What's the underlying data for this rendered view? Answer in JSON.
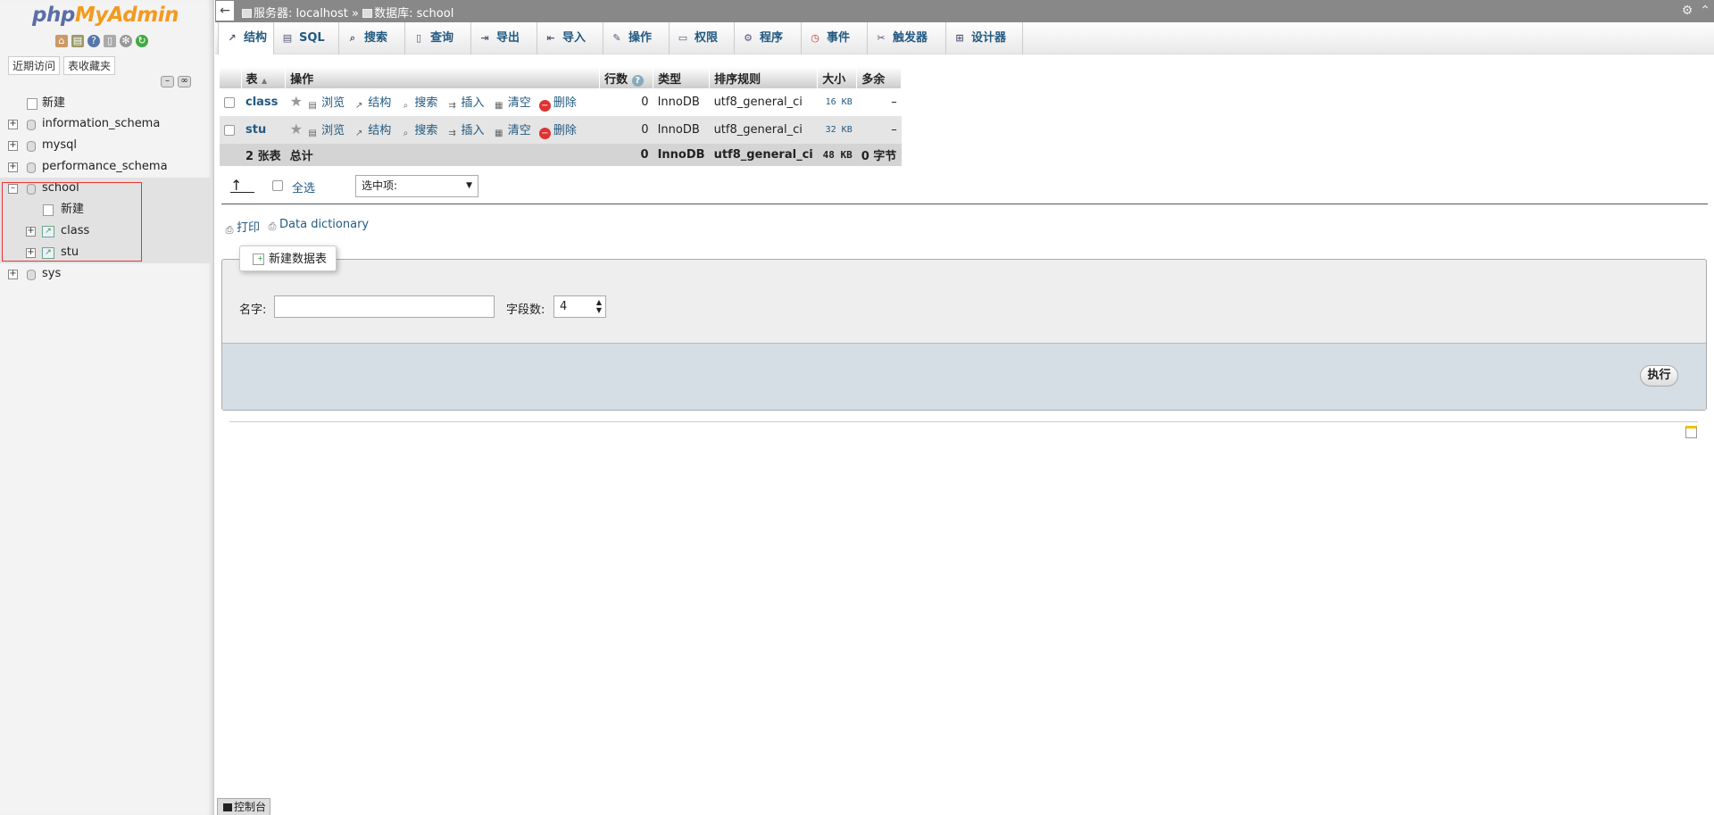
{
  "app": {
    "logo_part1": "php",
    "logo_part2": "MyAdmin"
  },
  "nav": {
    "tabs": [
      "近期访问",
      "表收藏夹"
    ],
    "tree": [
      {
        "label": "新建",
        "type": "new"
      },
      {
        "label": "information_schema",
        "type": "db"
      },
      {
        "label": "mysql",
        "type": "db"
      },
      {
        "label": "performance_schema",
        "type": "db"
      },
      {
        "label": "school",
        "type": "db-open"
      },
      {
        "label": "新建",
        "type": "sub-new"
      },
      {
        "label": "class",
        "type": "sub-table"
      },
      {
        "label": "stu",
        "type": "sub-table"
      },
      {
        "label": "sys",
        "type": "db"
      }
    ]
  },
  "breadcrumb": {
    "server": "服务器: localhost",
    "sep": "»",
    "database": "数据库: school"
  },
  "tabs": [
    "结构",
    "SQL",
    "搜索",
    "查询",
    "导出",
    "导入",
    "操作",
    "权限",
    "程序",
    "事件",
    "触发器",
    "设计器"
  ],
  "table": {
    "headers": [
      "表",
      "操作",
      "行数",
      "类型",
      "排序规则",
      "大小",
      "多余"
    ],
    "actions": [
      "浏览",
      "结构",
      "搜索",
      "插入",
      "清空",
      "删除"
    ],
    "rows": [
      {
        "name": "class",
        "rows": "0",
        "type": "InnoDB",
        "collation": "utf8_general_ci",
        "size": "16 KB",
        "overhead": "–"
      },
      {
        "name": "stu",
        "rows": "0",
        "type": "InnoDB",
        "collation": "utf8_general_ci",
        "size": "32 KB",
        "overhead": "–"
      }
    ],
    "footer": {
      "count": "2 张表",
      "total": "总计",
      "rows": "0",
      "type": "InnoDB",
      "collation": "utf8_general_ci",
      "size": "48 KB",
      "overhead": "0 字节"
    }
  },
  "bulk": {
    "select_all": "全选",
    "select_placeholder": "选中项:"
  },
  "links": {
    "print": "打印",
    "dictionary": "Data dictionary"
  },
  "create_table": {
    "legend": "新建数据表",
    "name_label": "名字:",
    "name_value": "",
    "fields_label": "字段数:",
    "fields_value": "4",
    "submit": "执行"
  },
  "console": {
    "label": "控制台"
  }
}
